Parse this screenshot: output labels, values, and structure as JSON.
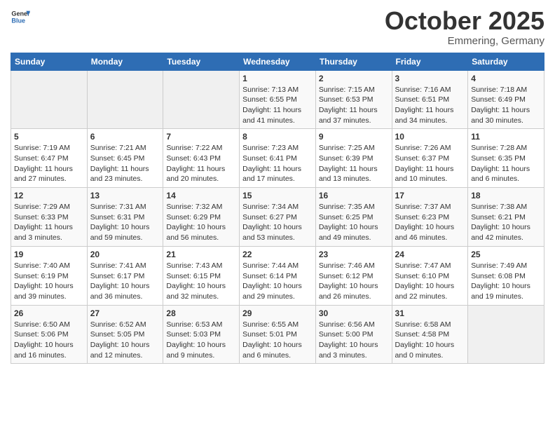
{
  "header": {
    "logo_general": "General",
    "logo_blue": "Blue",
    "title": "October 2025",
    "location": "Emmering, Germany"
  },
  "days_of_week": [
    "Sunday",
    "Monday",
    "Tuesday",
    "Wednesday",
    "Thursday",
    "Friday",
    "Saturday"
  ],
  "weeks": [
    [
      {
        "day": "",
        "sunrise": "",
        "sunset": "",
        "daylight": "",
        "empty": true
      },
      {
        "day": "",
        "sunrise": "",
        "sunset": "",
        "daylight": "",
        "empty": true
      },
      {
        "day": "",
        "sunrise": "",
        "sunset": "",
        "daylight": "",
        "empty": true
      },
      {
        "day": "1",
        "sunrise": "Sunrise: 7:13 AM",
        "sunset": "Sunset: 6:55 PM",
        "daylight": "Daylight: 11 hours and 41 minutes."
      },
      {
        "day": "2",
        "sunrise": "Sunrise: 7:15 AM",
        "sunset": "Sunset: 6:53 PM",
        "daylight": "Daylight: 11 hours and 37 minutes."
      },
      {
        "day": "3",
        "sunrise": "Sunrise: 7:16 AM",
        "sunset": "Sunset: 6:51 PM",
        "daylight": "Daylight: 11 hours and 34 minutes."
      },
      {
        "day": "4",
        "sunrise": "Sunrise: 7:18 AM",
        "sunset": "Sunset: 6:49 PM",
        "daylight": "Daylight: 11 hours and 30 minutes."
      }
    ],
    [
      {
        "day": "5",
        "sunrise": "Sunrise: 7:19 AM",
        "sunset": "Sunset: 6:47 PM",
        "daylight": "Daylight: 11 hours and 27 minutes."
      },
      {
        "day": "6",
        "sunrise": "Sunrise: 7:21 AM",
        "sunset": "Sunset: 6:45 PM",
        "daylight": "Daylight: 11 hours and 23 minutes."
      },
      {
        "day": "7",
        "sunrise": "Sunrise: 7:22 AM",
        "sunset": "Sunset: 6:43 PM",
        "daylight": "Daylight: 11 hours and 20 minutes."
      },
      {
        "day": "8",
        "sunrise": "Sunrise: 7:23 AM",
        "sunset": "Sunset: 6:41 PM",
        "daylight": "Daylight: 11 hours and 17 minutes."
      },
      {
        "day": "9",
        "sunrise": "Sunrise: 7:25 AM",
        "sunset": "Sunset: 6:39 PM",
        "daylight": "Daylight: 11 hours and 13 minutes."
      },
      {
        "day": "10",
        "sunrise": "Sunrise: 7:26 AM",
        "sunset": "Sunset: 6:37 PM",
        "daylight": "Daylight: 11 hours and 10 minutes."
      },
      {
        "day": "11",
        "sunrise": "Sunrise: 7:28 AM",
        "sunset": "Sunset: 6:35 PM",
        "daylight": "Daylight: 11 hours and 6 minutes."
      }
    ],
    [
      {
        "day": "12",
        "sunrise": "Sunrise: 7:29 AM",
        "sunset": "Sunset: 6:33 PM",
        "daylight": "Daylight: 11 hours and 3 minutes."
      },
      {
        "day": "13",
        "sunrise": "Sunrise: 7:31 AM",
        "sunset": "Sunset: 6:31 PM",
        "daylight": "Daylight: 10 hours and 59 minutes."
      },
      {
        "day": "14",
        "sunrise": "Sunrise: 7:32 AM",
        "sunset": "Sunset: 6:29 PM",
        "daylight": "Daylight: 10 hours and 56 minutes."
      },
      {
        "day": "15",
        "sunrise": "Sunrise: 7:34 AM",
        "sunset": "Sunset: 6:27 PM",
        "daylight": "Daylight: 10 hours and 53 minutes."
      },
      {
        "day": "16",
        "sunrise": "Sunrise: 7:35 AM",
        "sunset": "Sunset: 6:25 PM",
        "daylight": "Daylight: 10 hours and 49 minutes."
      },
      {
        "day": "17",
        "sunrise": "Sunrise: 7:37 AM",
        "sunset": "Sunset: 6:23 PM",
        "daylight": "Daylight: 10 hours and 46 minutes."
      },
      {
        "day": "18",
        "sunrise": "Sunrise: 7:38 AM",
        "sunset": "Sunset: 6:21 PM",
        "daylight": "Daylight: 10 hours and 42 minutes."
      }
    ],
    [
      {
        "day": "19",
        "sunrise": "Sunrise: 7:40 AM",
        "sunset": "Sunset: 6:19 PM",
        "daylight": "Daylight: 10 hours and 39 minutes."
      },
      {
        "day": "20",
        "sunrise": "Sunrise: 7:41 AM",
        "sunset": "Sunset: 6:17 PM",
        "daylight": "Daylight: 10 hours and 36 minutes."
      },
      {
        "day": "21",
        "sunrise": "Sunrise: 7:43 AM",
        "sunset": "Sunset: 6:15 PM",
        "daylight": "Daylight: 10 hours and 32 minutes."
      },
      {
        "day": "22",
        "sunrise": "Sunrise: 7:44 AM",
        "sunset": "Sunset: 6:14 PM",
        "daylight": "Daylight: 10 hours and 29 minutes."
      },
      {
        "day": "23",
        "sunrise": "Sunrise: 7:46 AM",
        "sunset": "Sunset: 6:12 PM",
        "daylight": "Daylight: 10 hours and 26 minutes."
      },
      {
        "day": "24",
        "sunrise": "Sunrise: 7:47 AM",
        "sunset": "Sunset: 6:10 PM",
        "daylight": "Daylight: 10 hours and 22 minutes."
      },
      {
        "day": "25",
        "sunrise": "Sunrise: 7:49 AM",
        "sunset": "Sunset: 6:08 PM",
        "daylight": "Daylight: 10 hours and 19 minutes."
      }
    ],
    [
      {
        "day": "26",
        "sunrise": "Sunrise: 6:50 AM",
        "sunset": "Sunset: 5:06 PM",
        "daylight": "Daylight: 10 hours and 16 minutes."
      },
      {
        "day": "27",
        "sunrise": "Sunrise: 6:52 AM",
        "sunset": "Sunset: 5:05 PM",
        "daylight": "Daylight: 10 hours and 12 minutes."
      },
      {
        "day": "28",
        "sunrise": "Sunrise: 6:53 AM",
        "sunset": "Sunset: 5:03 PM",
        "daylight": "Daylight: 10 hours and 9 minutes."
      },
      {
        "day": "29",
        "sunrise": "Sunrise: 6:55 AM",
        "sunset": "Sunset: 5:01 PM",
        "daylight": "Daylight: 10 hours and 6 minutes."
      },
      {
        "day": "30",
        "sunrise": "Sunrise: 6:56 AM",
        "sunset": "Sunset: 5:00 PM",
        "daylight": "Daylight: 10 hours and 3 minutes."
      },
      {
        "day": "31",
        "sunrise": "Sunrise: 6:58 AM",
        "sunset": "Sunset: 4:58 PM",
        "daylight": "Daylight: 10 hours and 0 minutes."
      },
      {
        "day": "",
        "sunrise": "",
        "sunset": "",
        "daylight": "",
        "empty": true
      }
    ]
  ]
}
